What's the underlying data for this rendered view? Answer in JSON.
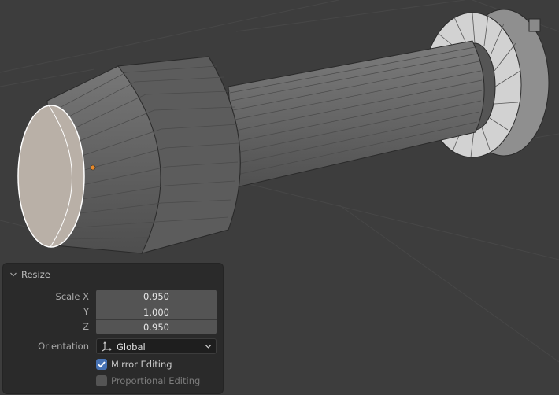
{
  "viewport": {
    "background": "#3d3d3d",
    "mesh_color": "#6b6b6b",
    "selected_face_color": "#b9b0a7",
    "vertex_color": "#e88a2a"
  },
  "redo_panel": {
    "title": "Resize",
    "collapse_icon": "chevron-down-icon",
    "scale_x": {
      "label": "Scale X",
      "value": "0.950"
    },
    "scale_y": {
      "label": "Y",
      "value": "1.000"
    },
    "scale_z": {
      "label": "Z",
      "value": "0.950"
    },
    "orientation": {
      "label": "Orientation",
      "value": "Global",
      "icon": "orientation-global-icon"
    },
    "mirror_editing": {
      "label": "Mirror Editing",
      "checked": true
    },
    "proportional_editing": {
      "label": "Proportional Editing",
      "checked": false
    },
    "accent_color": "#4772b3"
  }
}
